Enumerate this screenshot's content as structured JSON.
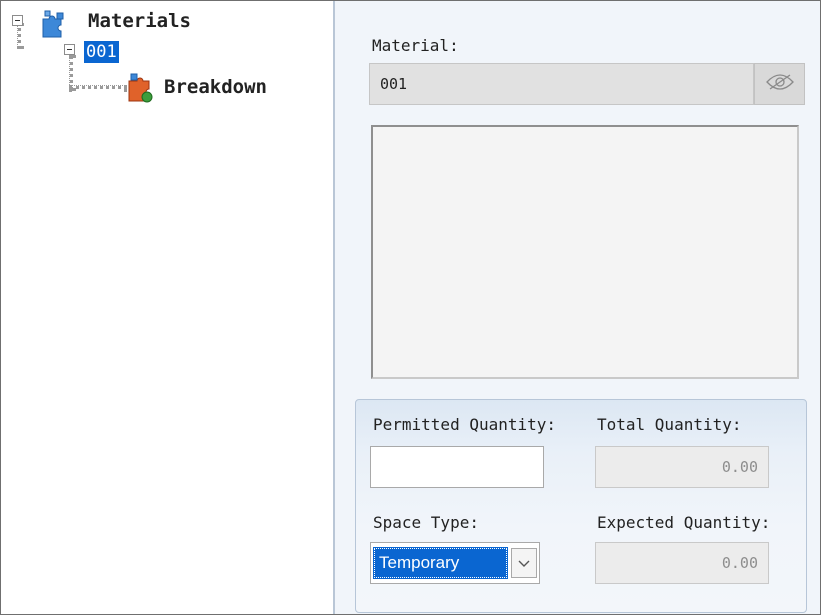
{
  "tree": {
    "root": {
      "label": "Materials",
      "icon": "puzzle-icon"
    },
    "child": {
      "label": "001",
      "selected": true
    },
    "leaf": {
      "label": "Breakdown",
      "icon": "breakdown-icon"
    }
  },
  "material": {
    "label": "Material:",
    "value": "001",
    "view_icon": "eye-icon"
  },
  "quantities": {
    "permitted_label": "Permitted Quantity:",
    "permitted_value": "",
    "total_label": "Total Quantity:",
    "total_value": "0.00",
    "space_type_label": "Space Type:",
    "space_type_value": "Temporary",
    "expected_label": "Expected Quantity:",
    "expected_value": "0.00"
  },
  "colors": {
    "selection": "#0a66d1",
    "panel_bg": "#f1f5fa"
  }
}
